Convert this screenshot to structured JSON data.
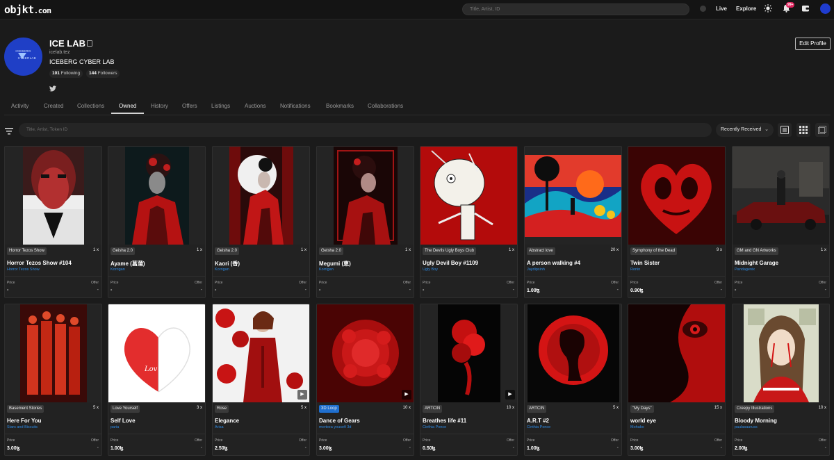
{
  "topbar": {
    "logo": "objkt",
    "logo_tld": ".com",
    "search_placeholder": "Title, Artist, ID",
    "nav": [
      "Live",
      "Explore"
    ],
    "notification_count": "99+"
  },
  "profile": {
    "name": "ICE LAB",
    "domain": "icelab.tez",
    "bio": "ICEBERG CYBER LAB",
    "avatar_text": "ICEBERG CYBERLAB",
    "following_count": "101",
    "following_label": "Following",
    "followers_count": "144",
    "followers_label": "Followers",
    "edit_button": "Edit Profile"
  },
  "tabs": [
    "Activity",
    "Created",
    "Collections",
    "Owned",
    "History",
    "Offers",
    "Listings",
    "Auctions",
    "Notifications",
    "Bookmarks",
    "Collaborations"
  ],
  "active_tab": "Owned",
  "filter": {
    "search_placeholder": "Title, Artist, Token ID",
    "sort_label": "Recently Received"
  },
  "card_labels": {
    "price": "Price",
    "offer": "Offer"
  },
  "cards": [
    {
      "collection": "Horror Tezos Show",
      "editions": "1 x",
      "title": "Horror Tezos Show #104",
      "artist": "Horror Tezos Show",
      "price": "-",
      "offer": "-"
    },
    {
      "collection": "Geisha 2.0",
      "editions": "1 x",
      "title": "Ayame (菖蒲)",
      "artist": "Korrigan",
      "price": "-",
      "offer": "-"
    },
    {
      "collection": "Geisha 2.0",
      "editions": "1 x",
      "title": "Kaori (香)",
      "artist": "Korrigan",
      "price": "-",
      "offer": "-"
    },
    {
      "collection": "Geisha 2.0",
      "editions": "1 x",
      "title": "Megumi (恵)",
      "artist": "Korrigan",
      "price": "-",
      "offer": "-"
    },
    {
      "collection": "The Devils Ugly Boys Club",
      "editions": "1 x",
      "title": "Ugly Devil Boy #1109",
      "artist": "Ugly Boy",
      "price": "-",
      "offer": "-"
    },
    {
      "collection": "Abstract love",
      "editions": "20 x",
      "title": "A person walking #4",
      "artist": "Jaydipsinh",
      "price": "1.00ꜩ",
      "offer": "-"
    },
    {
      "collection": "Symphony of the Dead",
      "editions": "9 x",
      "title": "Twin Sister",
      "artist": "Ronin",
      "price": "0.90ꜩ",
      "offer": "-"
    },
    {
      "collection": "GM and GN Artworks",
      "editions": "1 x",
      "title": "Midnight Garage",
      "artist": "Pandagenix",
      "price": "-",
      "offer": "-"
    },
    {
      "collection": "Basement Stories",
      "editions": "5 x",
      "title": "Here For You",
      "artist": "Stars and Biscuits",
      "price": "3.00ꜩ",
      "offer": "-"
    },
    {
      "collection": "Love Yourself",
      "editions": "3 x",
      "title": "Self Love",
      "artist": "paria",
      "price": "1.00ꜩ",
      "offer": "-"
    },
    {
      "collection": "Rose",
      "editions": "5 x",
      "title": "Elegance",
      "artist": "Arisa",
      "price": "2.50ꜩ",
      "offer": "-"
    },
    {
      "collection": "3D Loop",
      "editions": "10 x",
      "title": "Dance of Gears",
      "artist": "morteza yousefi 3d",
      "price": "3.00ꜩ",
      "offer": "-"
    },
    {
      "collection": "ARTCIN",
      "editions": "10 x",
      "title": "Breathes life #11",
      "artist": "Cinthia Ponce",
      "price": "0.50ꜩ",
      "offer": "-"
    },
    {
      "collection": "ARTCIN",
      "editions": "5 x",
      "title": "A.R.T #2",
      "artist": "Cinthia Ponce",
      "price": "1.00ꜩ",
      "offer": "-"
    },
    {
      "collection": "\"My Days\"",
      "editions": "15 x",
      "title": "world eye",
      "artist": "Mohako",
      "price": "3.00ꜩ",
      "offer": "-"
    },
    {
      "collection": "Creepy Illustrations",
      "editions": "10 x",
      "title": "Bloody Morning",
      "artist": "paulasauruss",
      "price": "2.00ꜩ",
      "offer": "-"
    }
  ],
  "colors": {
    "accent": "#2d8be6",
    "badge": "#e0245e",
    "avatar": "#1f3fc6",
    "tag_blue": "#1f6fcf"
  }
}
